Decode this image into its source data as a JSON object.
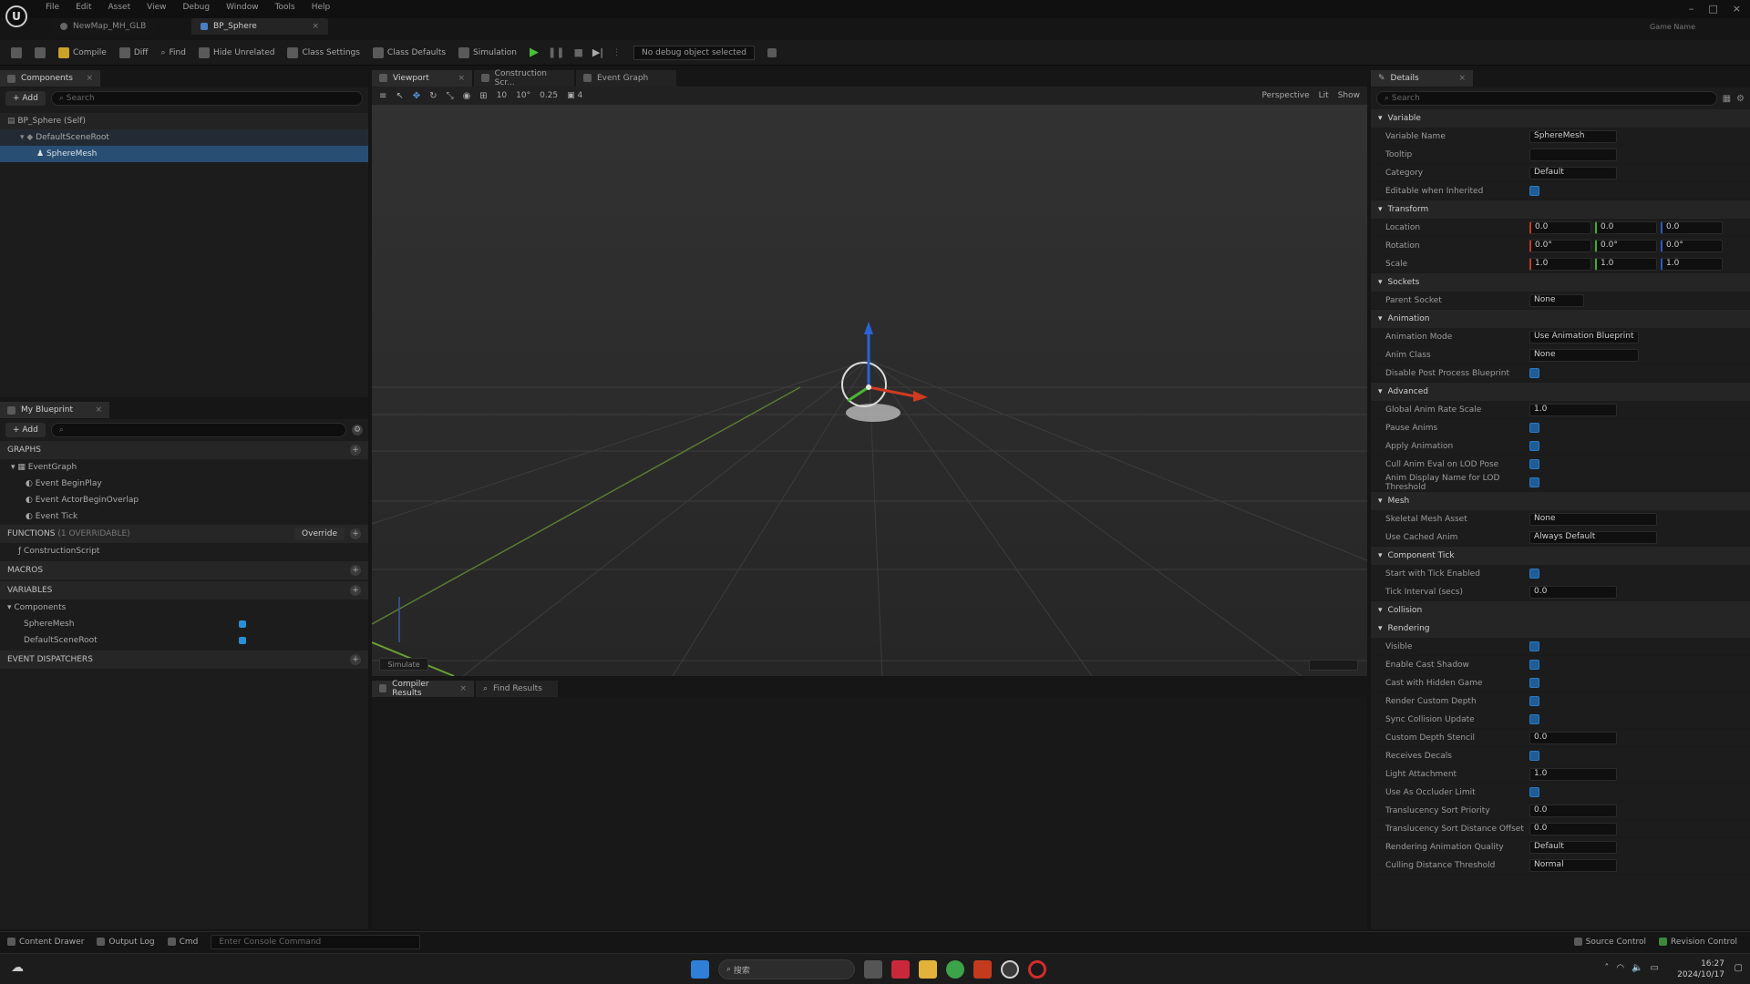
{
  "window": {
    "menu": [
      "File",
      "Edit",
      "Asset",
      "View",
      "Debug",
      "Window",
      "Tools",
      "Help"
    ],
    "tabs": [
      "NewMap_MH_GLB",
      "BP_Sphere"
    ],
    "account": "Game Name"
  },
  "toolbar": {
    "compile": "Compile",
    "diff": "Diff",
    "find": "Find",
    "hide_unrelated": "Hide Unrelated",
    "class_settings": "Class Settings",
    "class_defaults": "Class Defaults",
    "simulation": "Simulation",
    "debug_filter": "No debug object selected"
  },
  "components_panel": {
    "tab": "Components",
    "add": "+ Add",
    "search_placeholder": "Search",
    "items": [
      "BP_Sphere (Self)",
      "DefaultSceneRoot",
      "SphereMesh"
    ]
  },
  "my_blueprint": {
    "tab": "My Blueprint",
    "add": "+ Add",
    "sections": {
      "graphs": "GRAPHS",
      "event_graph": "EventGraph",
      "events": [
        "Event BeginPlay",
        "Event ActorBeginOverlap",
        "Event Tick"
      ],
      "functions": "FUNCTIONS",
      "functions_count": "(1 OVERRIDABLE)",
      "override": "Override",
      "construction": "ConstructionScript",
      "macros": "MACROS",
      "variables": "VARIABLES",
      "components": "Components",
      "component_vars": [
        "SphereMesh",
        "DefaultSceneRoot"
      ],
      "dispatchers": "EVENT DISPATCHERS"
    }
  },
  "center_tabs": [
    "Viewport",
    "Construction Scr...",
    "Event Graph"
  ],
  "viewport": {
    "perspective": "Perspective",
    "lit": "Lit",
    "show": "Show",
    "grid_snap": "10",
    "rot_snap": "10°",
    "scale_snap": "0.25",
    "speed": "4",
    "bottom_label": "Simulate"
  },
  "bottom_tabs": [
    "Compiler Results",
    "Find Results"
  ],
  "details": {
    "tab": "Details",
    "search_placeholder": "Search",
    "sections": {
      "variable": "Variable",
      "transform": "Transform",
      "sockets": "Sockets",
      "animation": "Animation",
      "advanced": "Advanced",
      "mesh": "Mesh",
      "component_tick": "Component Tick",
      "collision": "Collision",
      "rendering": "Rendering"
    },
    "variable_rows": [
      {
        "label": "Variable Name",
        "value": "SphereMesh"
      },
      {
        "label": "Tooltip",
        "value": ""
      },
      {
        "label": "Category",
        "value": "Default"
      },
      {
        "label": "Editable when Inherited",
        "value": ""
      }
    ],
    "transform_rows": [
      {
        "label": "Location",
        "x": "0.0",
        "y": "0.0",
        "z": "0.0"
      },
      {
        "label": "Rotation",
        "x": "0.0°",
        "y": "0.0°",
        "z": "0.0°"
      },
      {
        "label": "Scale",
        "x": "1.0",
        "y": "1.0",
        "z": "1.0"
      }
    ],
    "socket_row": {
      "label": "Parent Socket",
      "value": "None"
    },
    "animation_rows": [
      {
        "label": "Animation Mode",
        "value": "Use Animation Blueprint"
      },
      {
        "label": "Anim Class",
        "value": "None"
      },
      {
        "label": "Disable Post Process Blueprint",
        "value": ""
      }
    ],
    "advanced_rows": [
      {
        "label": "Global Anim Rate Scale",
        "value": "1.0"
      },
      {
        "label": "Pause Anims",
        "value": ""
      },
      {
        "label": "Apply Animation",
        "value": ""
      },
      {
        "label": "Cull Anim Eval on LOD Pose",
        "value": ""
      },
      {
        "label": "Anim Display Name for LOD Threshold",
        "value": ""
      }
    ],
    "mesh_rows": [
      {
        "label": "Skeletal Mesh Asset",
        "value": "None"
      },
      {
        "label": "Use Cached Anim",
        "value": "Always Default"
      }
    ],
    "tick_rows": [
      {
        "label": "Start with Tick Enabled",
        "value": ""
      },
      {
        "label": "Tick Interval (secs)",
        "value": "0.0"
      }
    ],
    "rendering_rows": [
      {
        "label": "Visible",
        "value": ""
      },
      {
        "label": "Enable Cast Shadow",
        "value": ""
      },
      {
        "label": "Cast with Hidden Game",
        "value": ""
      },
      {
        "label": "Render Custom Depth",
        "value": ""
      },
      {
        "label": "Sync Collision Update",
        "value": ""
      },
      {
        "label": "Custom Depth Stencil",
        "value": "0.0"
      },
      {
        "label": "Receives Decals",
        "value": ""
      },
      {
        "label": "Light Attachment",
        "value": "1.0"
      },
      {
        "label": "Use As Occluder Limit",
        "value": ""
      },
      {
        "label": "Translucency Sort Priority",
        "value": "0.0"
      },
      {
        "label": "Translucency Sort Distance Offset",
        "value": "0.0"
      },
      {
        "label": "Rendering Animation Quality",
        "value": "Default"
      },
      {
        "label": "Culling Distance Threshold",
        "value": "Normal"
      }
    ]
  },
  "statusbar": {
    "content_drawer": "Content Drawer",
    "output_log": "Output Log",
    "cmd": "Cmd",
    "cmd_placeholder": "Enter Console Command",
    "source_control": "Source Control",
    "revision": "Revision Control"
  },
  "taskbar": {
    "search_placeholder": "搜索",
    "time": "16:27",
    "date": "2024/10/17"
  }
}
